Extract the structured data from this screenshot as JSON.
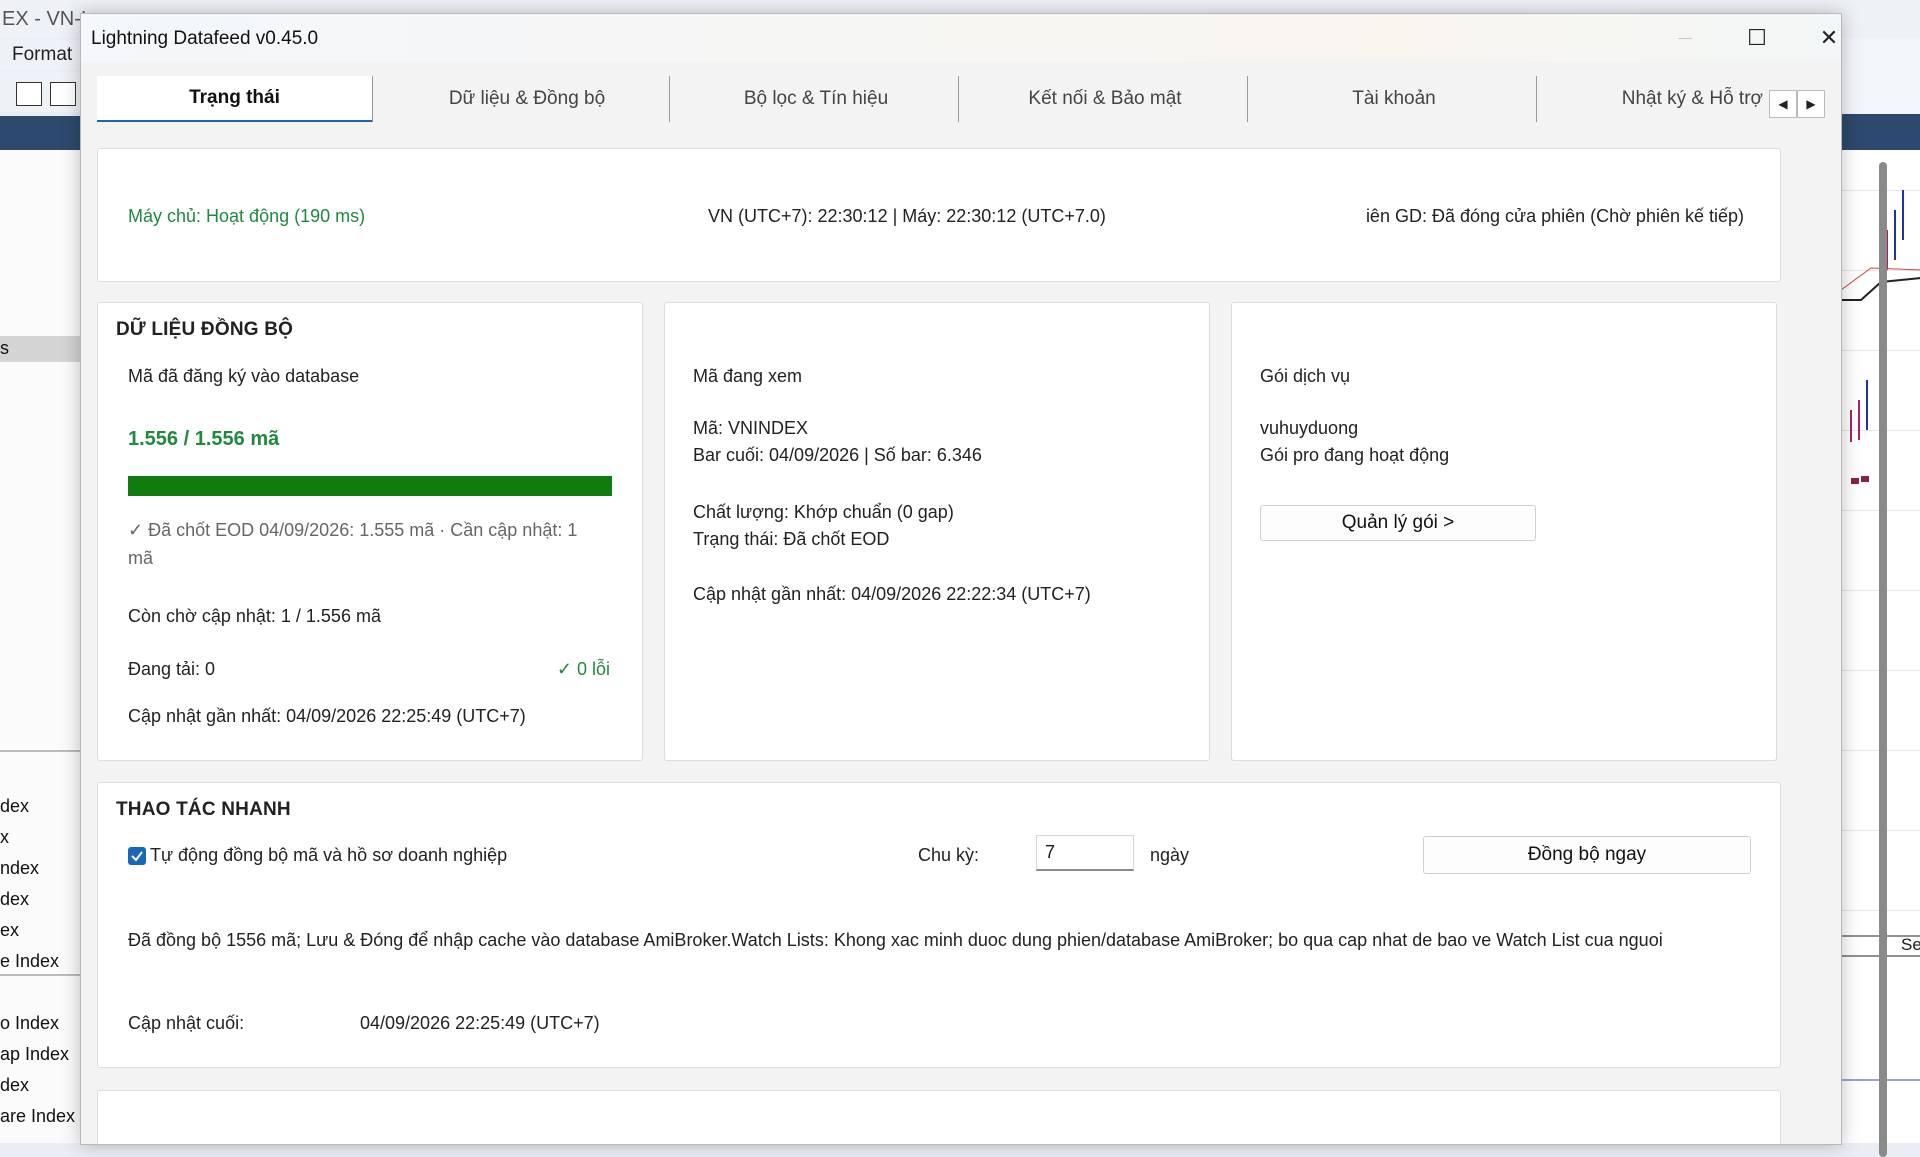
{
  "background": {
    "title": "EX - VN-Ir",
    "menu_format": "Format",
    "left_items": [
      "dex",
      "x",
      "ndex",
      "dex",
      "ex",
      "e Index",
      "o Index",
      "ap Index",
      "dex",
      "are Index"
    ],
    "left_small": "s",
    "right_label": "Se"
  },
  "window": {
    "title": "Lightning Datafeed v0.45.0",
    "controls": {
      "maximize": "☐",
      "close": "✕"
    }
  },
  "tabs": [
    {
      "label": "Trạng thái",
      "active": true
    },
    {
      "label": "Dữ liệu & Đồng bộ"
    },
    {
      "label": "Bộ lọc & Tín hiệu"
    },
    {
      "label": "Kết nối & Bảo mật"
    },
    {
      "label": "Tài khoản"
    },
    {
      "label": "Nhật ký & Hỗ trợ"
    }
  ],
  "tab_nav": {
    "prev": "◀",
    "next": "▶"
  },
  "status_bar": {
    "server": "Máy chủ: Hoạt động (190 ms)",
    "time": "VN (UTC+7): 22:30:12 | Máy: 22:30:12 (UTC+7.0)",
    "session": "iên GD: Đã đóng cửa phiên (Chờ phiên kế tiếp)"
  },
  "sync_card": {
    "heading": "DỮ LIỆU ĐỒNG BỘ",
    "registered_label": "Mã đã đăng ký vào database",
    "count": "1.556 / 1.556 mã",
    "progress_fraction": 1.0,
    "progress_color": "#107c10",
    "eod_line1": "✓ Đã chốt EOD 04/09/2026: 1.555 mã · Cần cập nhật: 1",
    "eod_line2": "mã",
    "pending": "Còn chờ cập nhật: 1 / 1.556 mã",
    "loading": "Đang tải: 0",
    "errors": "✓ 0 lỗi",
    "last_update": "Cập nhật gần nhất: 04/09/2026 22:25:49 (UTC+7)"
  },
  "viewing_card": {
    "title": "Mã đang xem",
    "symbol": "Mã: VNINDEX",
    "bars": "Bar cuối: 04/09/2026 | Số bar: 6.346",
    "quality": "Chất lượng: Khớp chuẩn (0 gap)",
    "state": "Trạng thái: Đã chốt EOD",
    "last_update": "Cập nhật gần nhất: 04/09/2026 22:22:34 (UTC+7)"
  },
  "service_card": {
    "title": "Gói dịch vụ",
    "user": "vuhuyduong",
    "plan": "Gói pro đang hoạt động",
    "manage_button": "Quản lý gói >"
  },
  "quick_actions": {
    "heading": "THAO TÁC NHANH",
    "auto_sync_label": "Tự động đồng bộ mã và hồ sơ doanh nghiệp",
    "auto_sync_checked": true,
    "cycle_label": "Chu kỳ:",
    "cycle_value": "7",
    "days_label": "ngày",
    "sync_button": "Đồng bộ ngay",
    "message": "Đã đồng bộ 1556 mã; Lưu & Đóng để nhập cache vào database AmiBroker.Watch Lists: Khong xac minh duoc dung phien/database AmiBroker; bo qua cap nhat de bao ve Watch List cua nguoi",
    "last_update_label": "Cập nhật cuối:",
    "last_update_value": "04/09/2026 22:25:49 (UTC+7)"
  }
}
